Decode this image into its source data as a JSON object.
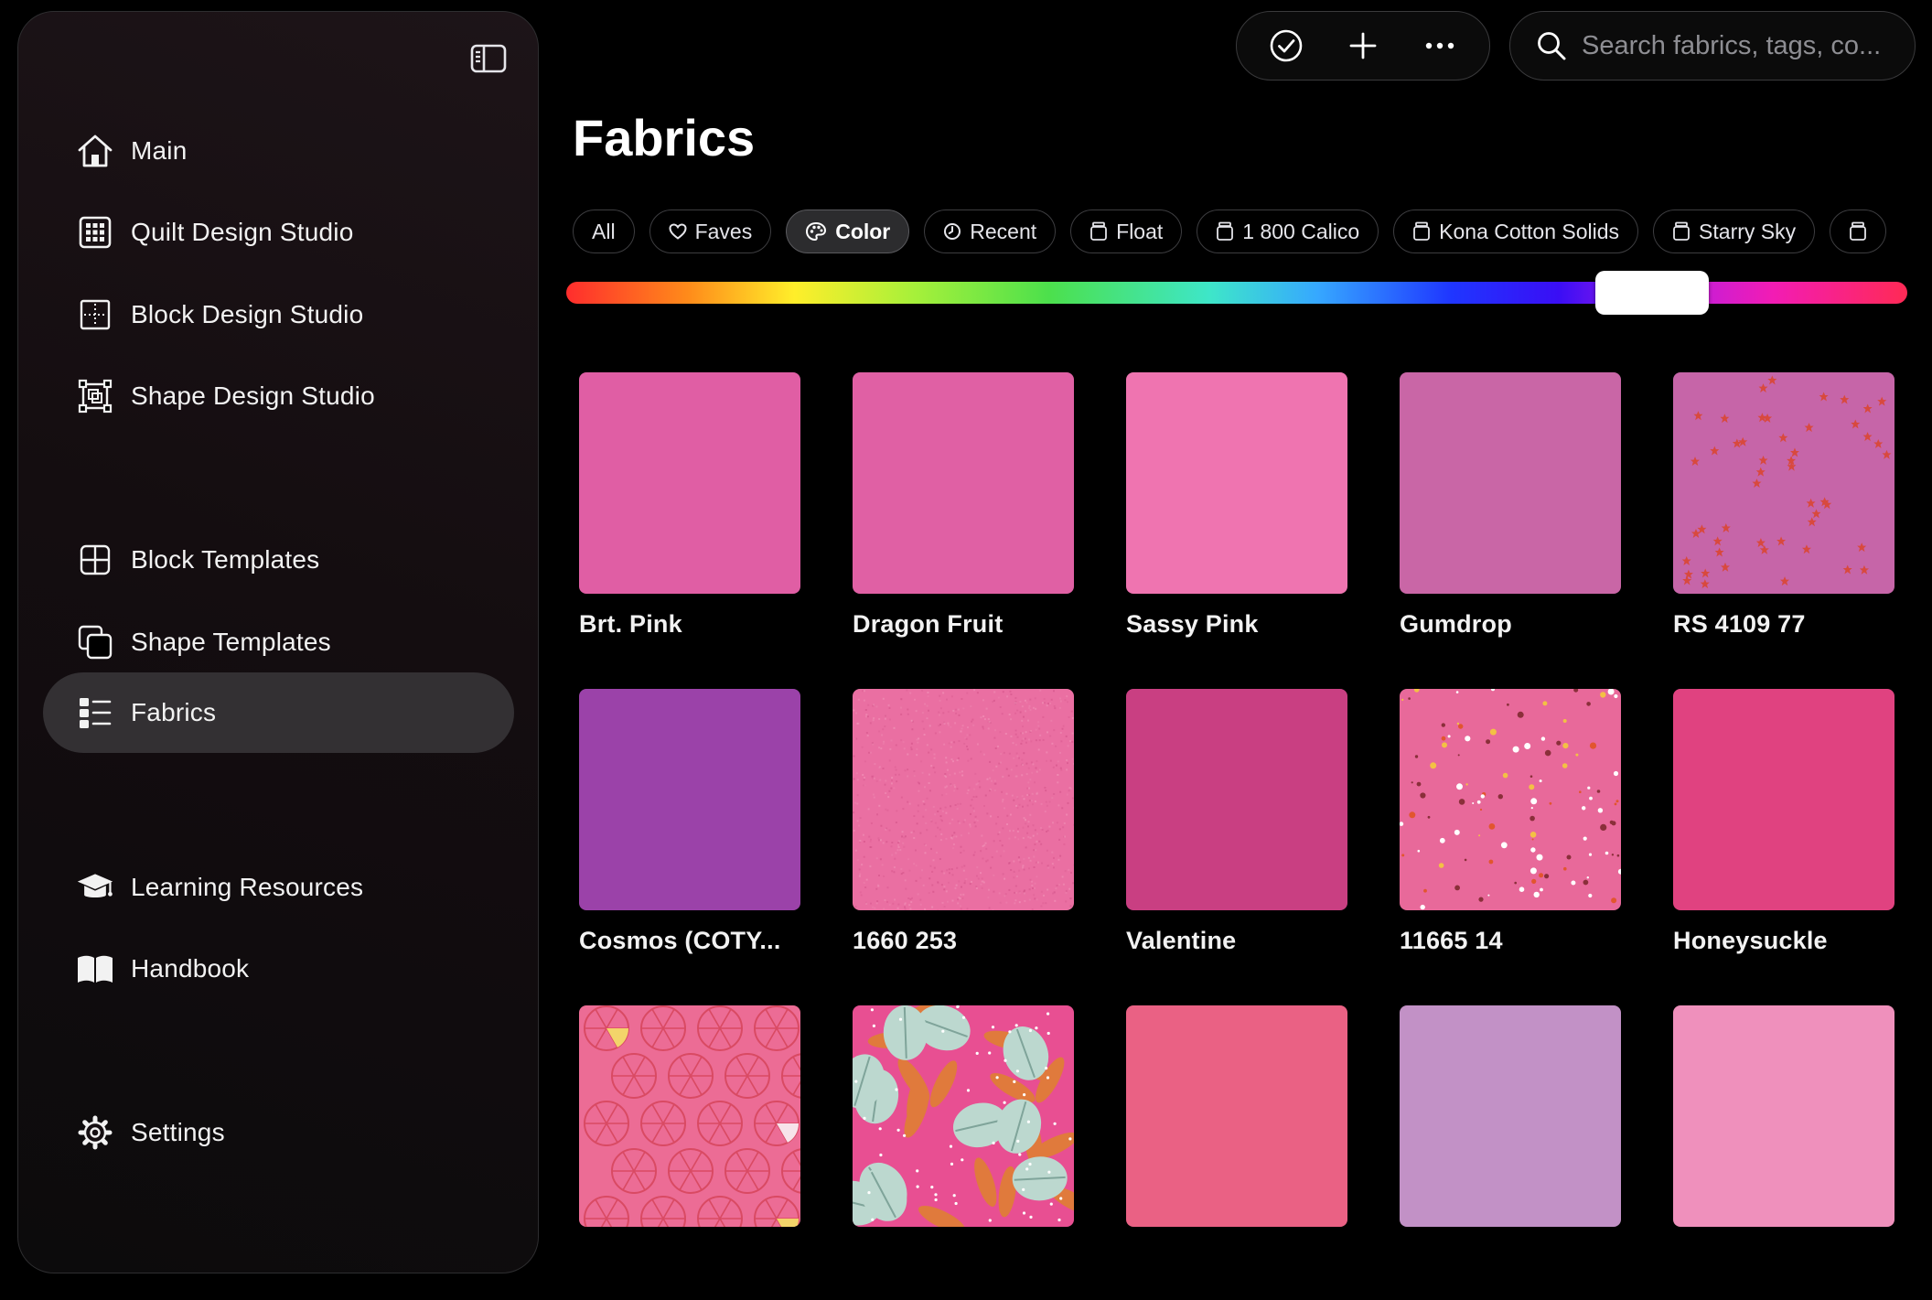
{
  "sidebar": {
    "items": [
      {
        "id": "main",
        "label": "Main",
        "icon": "house-icon",
        "active": false
      },
      {
        "id": "quilt",
        "label": "Quilt Design Studio",
        "icon": "grid-icon",
        "active": false
      },
      {
        "id": "block",
        "label": "Block Design Studio",
        "icon": "block-dotted-icon",
        "active": false
      },
      {
        "id": "shape",
        "label": "Shape Design Studio",
        "icon": "shape-select-icon",
        "active": false
      },
      {
        "id": "block-templates",
        "label": "Block Templates",
        "icon": "block-template-icon",
        "active": false
      },
      {
        "id": "shape-templates",
        "label": "Shape Templates",
        "icon": "shape-template-icon",
        "active": false
      },
      {
        "id": "fabrics",
        "label": "Fabrics",
        "icon": "list-icon",
        "active": true
      },
      {
        "id": "learning",
        "label": "Learning Resources",
        "icon": "graduation-cap-icon",
        "active": false
      },
      {
        "id": "handbook",
        "label": "Handbook",
        "icon": "book-icon",
        "active": false
      },
      {
        "id": "settings",
        "label": "Settings",
        "icon": "gear-icon",
        "active": false
      }
    ]
  },
  "search": {
    "placeholder": "Search fabrics, tags, co..."
  },
  "page": {
    "title": "Fabrics"
  },
  "filters": [
    {
      "label": "All",
      "icon": "",
      "active": false
    },
    {
      "label": "Faves",
      "icon": "heart-icon",
      "active": false
    },
    {
      "label": "Color",
      "icon": "palette-icon",
      "active": true
    },
    {
      "label": "Recent",
      "icon": "clock-icon",
      "active": false
    },
    {
      "label": "Float",
      "icon": "jar-icon",
      "active": false
    },
    {
      "label": "1 800 Calico",
      "icon": "jar-icon",
      "active": false
    },
    {
      "label": "Kona Cotton Solids",
      "icon": "jar-icon",
      "active": false
    },
    {
      "label": "Starry Sky",
      "icon": "jar-icon",
      "active": false
    },
    {
      "label": "",
      "icon": "jar-icon",
      "active": false
    }
  ],
  "hue_slider": {
    "value": 0.81
  },
  "fabrics": [
    {
      "name": "Brt. Pink",
      "color": "#e05ea4",
      "pattern": "solid"
    },
    {
      "name": "Dragon Fruit",
      "color": "#e060a4",
      "pattern": "solid"
    },
    {
      "name": "Sassy Pink",
      "color": "#ef74b0",
      "pattern": "solid"
    },
    {
      "name": "Gumdrop",
      "color": "#c966a6",
      "pattern": "solid"
    },
    {
      "name": "RS 4109 77",
      "color": "#c665a8",
      "pattern": "stars"
    },
    {
      "name": "Cosmos (COTY...",
      "color": "#9b42a9",
      "pattern": "solid"
    },
    {
      "name": "1660 253",
      "color": "#ea6fa2",
      "pattern": "texture"
    },
    {
      "name": "Valentine",
      "color": "#c93f82",
      "pattern": "solid"
    },
    {
      "name": "11665 14",
      "color": "#e8699a",
      "pattern": "dots"
    },
    {
      "name": "Honeysuckle",
      "color": "#e04280",
      "pattern": "solid"
    },
    {
      "name": "",
      "color": "#ec6c95",
      "pattern": "citrus"
    },
    {
      "name": "",
      "color": "#e84f92",
      "pattern": "leaves"
    },
    {
      "name": "",
      "color": "#ea6184",
      "pattern": "solid"
    },
    {
      "name": "",
      "color": "#c291c6",
      "pattern": "solid"
    },
    {
      "name": "",
      "color": "#ef90bc",
      "pattern": "solid"
    }
  ]
}
